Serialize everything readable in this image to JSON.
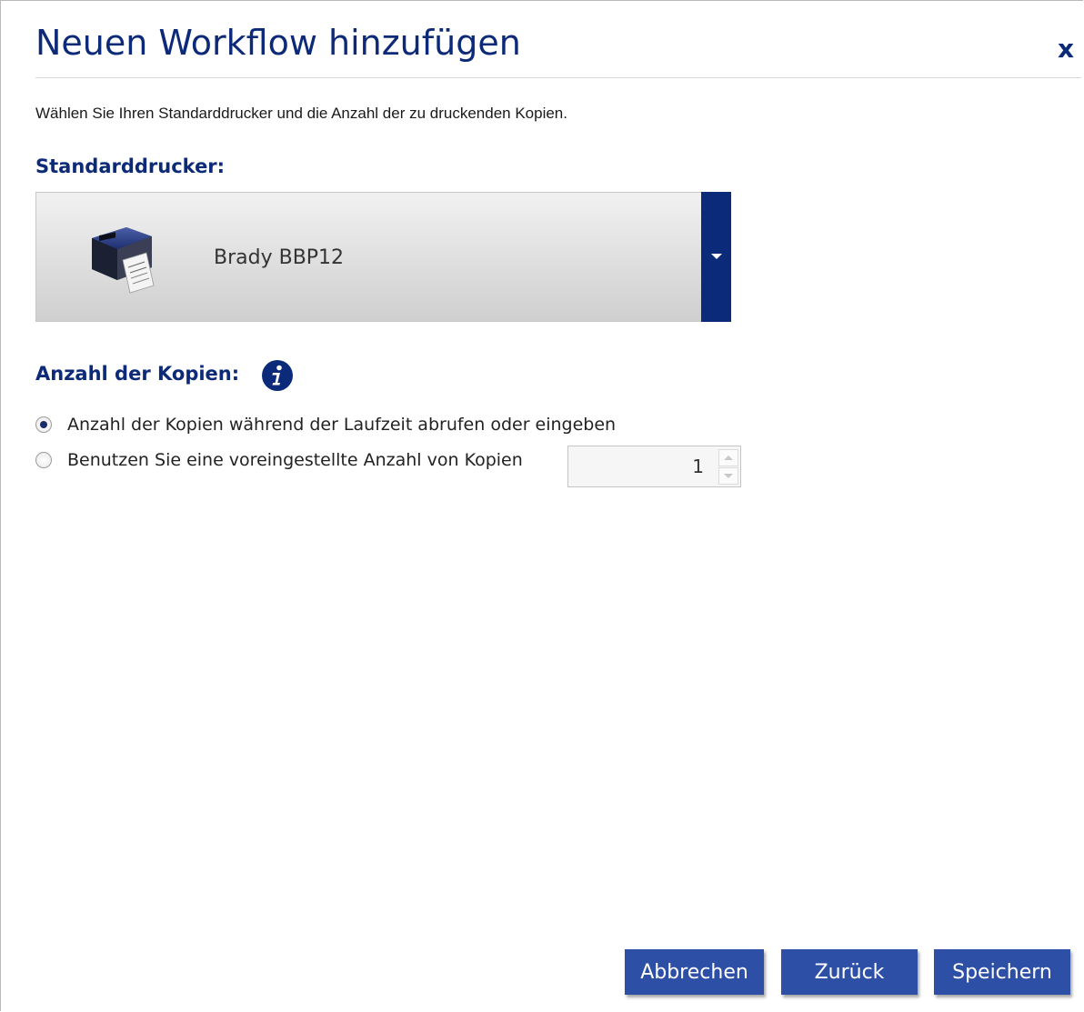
{
  "dialog": {
    "title": "Neuen Workflow hinzufügen",
    "close_label": "x",
    "description": "Wählen Sie Ihren Standarddrucker und die Anzahl der zu druckenden Kopien."
  },
  "printer": {
    "section_label": "Standarddrucker:",
    "selected_name": "Brady BBP12",
    "image_icon": "printer-icon",
    "dropdown_icon": "caret-down-icon"
  },
  "copies": {
    "section_label": "Anzahl der Kopien:",
    "info_icon": "info-icon",
    "options": [
      {
        "label": "Anzahl der Kopien während der Laufzeit abrufen oder eingeben",
        "checked": true
      },
      {
        "label": "Benutzen Sie eine voreingestellte Anzahl von Kopien",
        "checked": false
      }
    ],
    "preset_count": "1"
  },
  "footer": {
    "cancel_label": "Abbrechen",
    "back_label": "Zurück",
    "save_label": "Speichern"
  },
  "colors": {
    "accent": "#0d2a78",
    "button": "#2e4fa6",
    "dropdown": "#0b2b7a"
  }
}
